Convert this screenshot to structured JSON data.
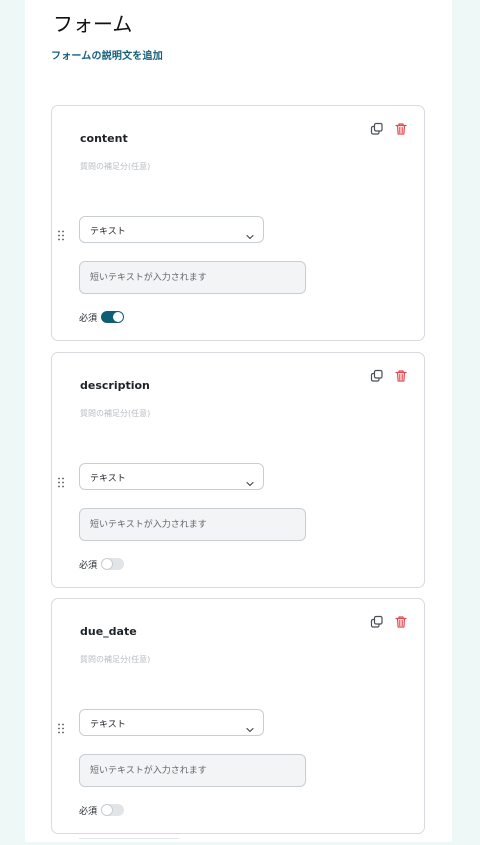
{
  "form": {
    "title": "フォーム",
    "add_description_label": "フォームの説明文を追加"
  },
  "questions": [
    {
      "title": "content",
      "subtitle_placeholder": "質問の補足分(任意)",
      "type_selected": "テキスト",
      "answer_placeholder": "短いテキストが入力されます",
      "required_label": "必須",
      "required": true
    },
    {
      "title": "description",
      "subtitle_placeholder": "質問の補足分(任意)",
      "type_selected": "テキスト",
      "answer_placeholder": "短いテキストが入力されます",
      "required_label": "必須",
      "required": false
    },
    {
      "title": "due_date",
      "subtitle_placeholder": "質問の補足分(任意)",
      "type_selected": "テキスト",
      "answer_placeholder": "短いテキストが入力されます",
      "required_label": "必須",
      "required": false
    }
  ],
  "icons": {
    "copy": "copy-icon",
    "delete": "trash-icon",
    "drag": "drag-handle-icon",
    "dropdown": "chevron-down-icon"
  },
  "colors": {
    "accent": "#0f5f74",
    "link": "#14607a",
    "delete": "#e5484d",
    "background": "#eef8f6"
  }
}
